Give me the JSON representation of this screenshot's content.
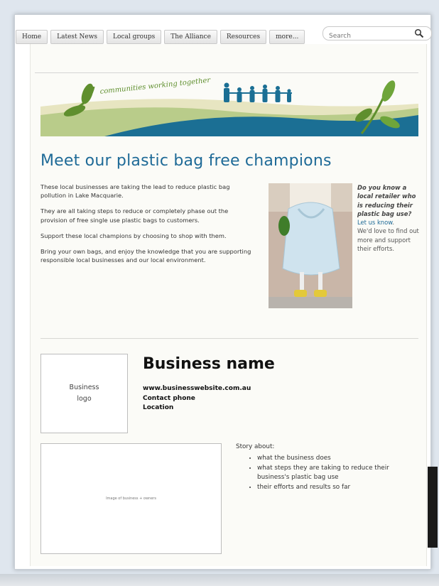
{
  "nav": {
    "tabs": [
      "Home",
      "Latest News",
      "Local groups",
      "The Alliance",
      "Resources",
      "more..."
    ]
  },
  "search": {
    "placeholder": "Search"
  },
  "banner": {
    "tagline": "communities working together"
  },
  "page_title": "Meet our plastic bag free champions",
  "intro": {
    "p1": "These local businesses are taking the lead to reduce plastic bag pollution in Lake Macquarie.",
    "p2": "They are all taking steps to reduce or completely phase out the provision of free single use plastic bags to customers.",
    "p3": "Support these local champions by choosing to shop with them.",
    "p4": "Bring your own bags, and enjoy the knowledge that you are supporting responsible local businesses and our local environment."
  },
  "aside": {
    "question": "Do you know a local retailer who is reducing their plastic bag use?",
    "link": "Let us know",
    "link_suffix": ".",
    "text": "We'd love to find out more and support their efforts."
  },
  "business": {
    "logo_placeholder": "Business logo",
    "name": "Business name",
    "website": "www.businesswebsite.com.au",
    "phone": "Contact phone",
    "location": "Location",
    "image_placeholder": "Image of business + owners"
  },
  "story": {
    "heading": "Story about:",
    "items": [
      "what the business does",
      "what steps they are taking to reduce their business's plastic bag use",
      "their efforts and results so far"
    ]
  },
  "colors": {
    "accent": "#1e6a97",
    "banner_blue": "#1b6f94",
    "leaf_green": "#5f8f2e"
  }
}
